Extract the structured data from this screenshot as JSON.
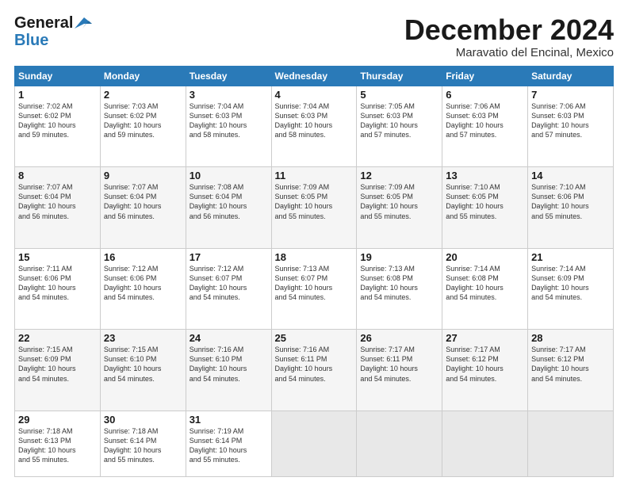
{
  "header": {
    "logo_line1": "General",
    "logo_line2": "Blue",
    "title": "December 2024",
    "subtitle": "Maravatio del Encinal, Mexico"
  },
  "weekdays": [
    "Sunday",
    "Monday",
    "Tuesday",
    "Wednesday",
    "Thursday",
    "Friday",
    "Saturday"
  ],
  "weeks": [
    [
      {
        "day": "1",
        "info": "Sunrise: 7:02 AM\nSunset: 6:02 PM\nDaylight: 10 hours\nand 59 minutes."
      },
      {
        "day": "2",
        "info": "Sunrise: 7:03 AM\nSunset: 6:02 PM\nDaylight: 10 hours\nand 59 minutes."
      },
      {
        "day": "3",
        "info": "Sunrise: 7:04 AM\nSunset: 6:03 PM\nDaylight: 10 hours\nand 58 minutes."
      },
      {
        "day": "4",
        "info": "Sunrise: 7:04 AM\nSunset: 6:03 PM\nDaylight: 10 hours\nand 58 minutes."
      },
      {
        "day": "5",
        "info": "Sunrise: 7:05 AM\nSunset: 6:03 PM\nDaylight: 10 hours\nand 57 minutes."
      },
      {
        "day": "6",
        "info": "Sunrise: 7:06 AM\nSunset: 6:03 PM\nDaylight: 10 hours\nand 57 minutes."
      },
      {
        "day": "7",
        "info": "Sunrise: 7:06 AM\nSunset: 6:03 PM\nDaylight: 10 hours\nand 57 minutes."
      }
    ],
    [
      {
        "day": "8",
        "info": "Sunrise: 7:07 AM\nSunset: 6:04 PM\nDaylight: 10 hours\nand 56 minutes."
      },
      {
        "day": "9",
        "info": "Sunrise: 7:07 AM\nSunset: 6:04 PM\nDaylight: 10 hours\nand 56 minutes."
      },
      {
        "day": "10",
        "info": "Sunrise: 7:08 AM\nSunset: 6:04 PM\nDaylight: 10 hours\nand 56 minutes."
      },
      {
        "day": "11",
        "info": "Sunrise: 7:09 AM\nSunset: 6:05 PM\nDaylight: 10 hours\nand 55 minutes."
      },
      {
        "day": "12",
        "info": "Sunrise: 7:09 AM\nSunset: 6:05 PM\nDaylight: 10 hours\nand 55 minutes."
      },
      {
        "day": "13",
        "info": "Sunrise: 7:10 AM\nSunset: 6:05 PM\nDaylight: 10 hours\nand 55 minutes."
      },
      {
        "day": "14",
        "info": "Sunrise: 7:10 AM\nSunset: 6:06 PM\nDaylight: 10 hours\nand 55 minutes."
      }
    ],
    [
      {
        "day": "15",
        "info": "Sunrise: 7:11 AM\nSunset: 6:06 PM\nDaylight: 10 hours\nand 54 minutes."
      },
      {
        "day": "16",
        "info": "Sunrise: 7:12 AM\nSunset: 6:06 PM\nDaylight: 10 hours\nand 54 minutes."
      },
      {
        "day": "17",
        "info": "Sunrise: 7:12 AM\nSunset: 6:07 PM\nDaylight: 10 hours\nand 54 minutes."
      },
      {
        "day": "18",
        "info": "Sunrise: 7:13 AM\nSunset: 6:07 PM\nDaylight: 10 hours\nand 54 minutes."
      },
      {
        "day": "19",
        "info": "Sunrise: 7:13 AM\nSunset: 6:08 PM\nDaylight: 10 hours\nand 54 minutes."
      },
      {
        "day": "20",
        "info": "Sunrise: 7:14 AM\nSunset: 6:08 PM\nDaylight: 10 hours\nand 54 minutes."
      },
      {
        "day": "21",
        "info": "Sunrise: 7:14 AM\nSunset: 6:09 PM\nDaylight: 10 hours\nand 54 minutes."
      }
    ],
    [
      {
        "day": "22",
        "info": "Sunrise: 7:15 AM\nSunset: 6:09 PM\nDaylight: 10 hours\nand 54 minutes."
      },
      {
        "day": "23",
        "info": "Sunrise: 7:15 AM\nSunset: 6:10 PM\nDaylight: 10 hours\nand 54 minutes."
      },
      {
        "day": "24",
        "info": "Sunrise: 7:16 AM\nSunset: 6:10 PM\nDaylight: 10 hours\nand 54 minutes."
      },
      {
        "day": "25",
        "info": "Sunrise: 7:16 AM\nSunset: 6:11 PM\nDaylight: 10 hours\nand 54 minutes."
      },
      {
        "day": "26",
        "info": "Sunrise: 7:17 AM\nSunset: 6:11 PM\nDaylight: 10 hours\nand 54 minutes."
      },
      {
        "day": "27",
        "info": "Sunrise: 7:17 AM\nSunset: 6:12 PM\nDaylight: 10 hours\nand 54 minutes."
      },
      {
        "day": "28",
        "info": "Sunrise: 7:17 AM\nSunset: 6:12 PM\nDaylight: 10 hours\nand 54 minutes."
      }
    ],
    [
      {
        "day": "29",
        "info": "Sunrise: 7:18 AM\nSunset: 6:13 PM\nDaylight: 10 hours\nand 55 minutes."
      },
      {
        "day": "30",
        "info": "Sunrise: 7:18 AM\nSunset: 6:14 PM\nDaylight: 10 hours\nand 55 minutes."
      },
      {
        "day": "31",
        "info": "Sunrise: 7:19 AM\nSunset: 6:14 PM\nDaylight: 10 hours\nand 55 minutes."
      },
      {
        "day": "",
        "info": ""
      },
      {
        "day": "",
        "info": ""
      },
      {
        "day": "",
        "info": ""
      },
      {
        "day": "",
        "info": ""
      }
    ]
  ]
}
